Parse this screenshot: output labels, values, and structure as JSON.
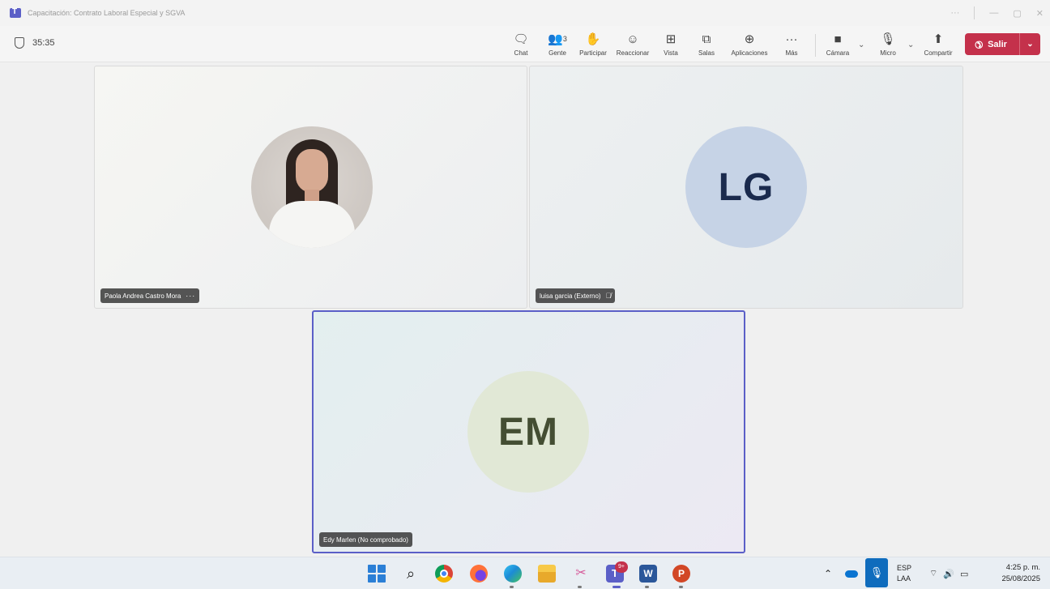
{
  "window": {
    "title": "Capacitación: Contrato Laboral Especial y SGVA",
    "controls": [
      "···",
      "—",
      "▢",
      "✕"
    ]
  },
  "meeting": {
    "timer": "35:35",
    "people_count": "3",
    "toolbar": {
      "chat": "Chat",
      "people": "Gente",
      "raise": "Participar",
      "react": "Reaccionar",
      "view": "Vista",
      "rooms": "Salas",
      "apps": "Aplicaciones",
      "more": "Más",
      "camera": "Cámara",
      "mic": "Micro",
      "share": "Compartir",
      "leave": "Salir"
    }
  },
  "participants": [
    {
      "name": "Paola Andrea Castro Mora",
      "initials": "",
      "has_photo": true,
      "extra": "···"
    },
    {
      "name": "luisa garcia (Externo)",
      "initials": "LG",
      "has_photo": false,
      "muted": true
    },
    {
      "name": "Edy Marlen (No comprobado)",
      "initials": "EM",
      "has_photo": false,
      "active_speaker": true
    }
  ],
  "taskbar": {
    "teams_badge": "9+",
    "language": {
      "line1": "ESP",
      "line2": "LAA"
    },
    "time": "4:25 p. m.",
    "date": "25/08/2025"
  },
  "colors": {
    "accent": "#5b5fc7",
    "leave": "#c4314b",
    "lg_avatar": "#c6d3e6",
    "em_avatar": "#e1e8d6"
  }
}
